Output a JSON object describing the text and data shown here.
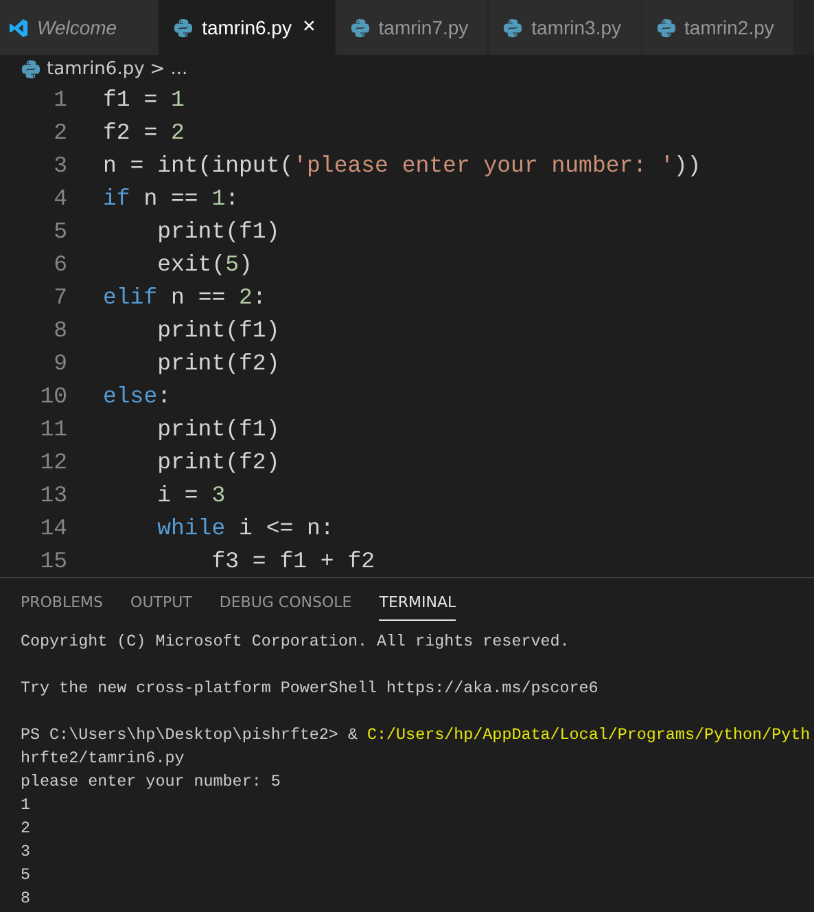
{
  "tabs": [
    {
      "label": "Welcome",
      "kind": "welcome",
      "preview": true,
      "selected": false
    },
    {
      "label": "tamrin6.py",
      "kind": "python",
      "preview": false,
      "selected": true,
      "close": "×"
    },
    {
      "label": "tamrin7.py",
      "kind": "python",
      "preview": false,
      "selected": false
    },
    {
      "label": "tamrin3.py",
      "kind": "python",
      "preview": false,
      "selected": false
    },
    {
      "label": "tamrin2.py",
      "kind": "python",
      "preview": false,
      "selected": false
    }
  ],
  "breadcrumb": {
    "file": "tamrin6.py",
    "separator": ">",
    "more": "..."
  },
  "code_lines": [
    {
      "number": "1",
      "tokens": [
        {
          "kind": "plain",
          "text": "f1 = "
        },
        {
          "kind": "num",
          "text": "1"
        }
      ]
    },
    {
      "number": "2",
      "tokens": [
        {
          "kind": "plain",
          "text": "f2 = "
        },
        {
          "kind": "num",
          "text": "2"
        }
      ]
    },
    {
      "number": "3",
      "tokens": [
        {
          "kind": "plain",
          "text": "n = int(input("
        },
        {
          "kind": "str",
          "text": "'please enter your number: '"
        },
        {
          "kind": "plain",
          "text": "))"
        }
      ]
    },
    {
      "number": "4",
      "tokens": [
        {
          "kind": "kw",
          "text": "if"
        },
        {
          "kind": "plain",
          "text": " n == "
        },
        {
          "kind": "num",
          "text": "1"
        },
        {
          "kind": "plain",
          "text": ":"
        }
      ]
    },
    {
      "number": "5",
      "tokens": [
        {
          "kind": "plain",
          "text": "    print(f1)"
        }
      ]
    },
    {
      "number": "6",
      "tokens": [
        {
          "kind": "plain",
          "text": "    exit("
        },
        {
          "kind": "num",
          "text": "5"
        },
        {
          "kind": "plain",
          "text": ")"
        }
      ]
    },
    {
      "number": "7",
      "tokens": [
        {
          "kind": "kw",
          "text": "elif"
        },
        {
          "kind": "plain",
          "text": " n == "
        },
        {
          "kind": "num",
          "text": "2"
        },
        {
          "kind": "plain",
          "text": ":"
        }
      ]
    },
    {
      "number": "8",
      "tokens": [
        {
          "kind": "plain",
          "text": "    print(f1)"
        }
      ]
    },
    {
      "number": "9",
      "tokens": [
        {
          "kind": "plain",
          "text": "    print(f2)"
        }
      ]
    },
    {
      "number": "10",
      "tokens": [
        {
          "kind": "kw",
          "text": "else"
        },
        {
          "kind": "plain",
          "text": ":"
        }
      ]
    },
    {
      "number": "11",
      "tokens": [
        {
          "kind": "plain",
          "text": "    print(f1)"
        }
      ]
    },
    {
      "number": "12",
      "tokens": [
        {
          "kind": "plain",
          "text": "    print(f2)"
        }
      ]
    },
    {
      "number": "13",
      "tokens": [
        {
          "kind": "plain",
          "text": "    i = "
        },
        {
          "kind": "num",
          "text": "3"
        }
      ]
    },
    {
      "number": "14",
      "tokens": [
        {
          "kind": "kw",
          "text": "    while"
        },
        {
          "kind": "plain",
          "text": " i <= n:"
        }
      ]
    },
    {
      "number": "15",
      "tokens": [
        {
          "kind": "plain",
          "text": "        f3 = f1 + f2"
        }
      ]
    }
  ],
  "panel_tabs": [
    {
      "label": "PROBLEMS",
      "selected": false
    },
    {
      "label": "OUTPUT",
      "selected": false
    },
    {
      "label": "DEBUG CONSOLE",
      "selected": false
    },
    {
      "label": "TERMINAL",
      "selected": true
    }
  ],
  "terminal_lines": [
    {
      "kind": "text",
      "segments": [
        {
          "kind": "plain",
          "text": "Copyright (C) Microsoft Corporation. All rights reserved."
        }
      ]
    },
    {
      "kind": "blank"
    },
    {
      "kind": "text",
      "segments": [
        {
          "kind": "plain",
          "text": "Try the new cross-platform PowerShell https://aka.ms/pscore6"
        }
      ]
    },
    {
      "kind": "blank"
    },
    {
      "kind": "text",
      "segments": [
        {
          "kind": "plain",
          "text": "PS C:\\Users\\hp\\Desktop\\pishrfte2> & "
        },
        {
          "kind": "path",
          "text": "C:/Users/hp/AppData/Local/Programs/Python/Pyth"
        }
      ]
    },
    {
      "kind": "text",
      "segments": [
        {
          "kind": "plain",
          "text": "hrfte2/tamrin6.py"
        }
      ]
    },
    {
      "kind": "text",
      "segments": [
        {
          "kind": "plain",
          "text": "please enter your number: 5"
        }
      ]
    },
    {
      "kind": "text",
      "segments": [
        {
          "kind": "plain",
          "text": "1"
        }
      ]
    },
    {
      "kind": "text",
      "segments": [
        {
          "kind": "plain",
          "text": "2"
        }
      ]
    },
    {
      "kind": "text",
      "segments": [
        {
          "kind": "plain",
          "text": "3"
        }
      ]
    },
    {
      "kind": "text",
      "segments": [
        {
          "kind": "plain",
          "text": "5"
        }
      ]
    },
    {
      "kind": "text",
      "segments": [
        {
          "kind": "plain",
          "text": "8"
        }
      ]
    }
  ]
}
